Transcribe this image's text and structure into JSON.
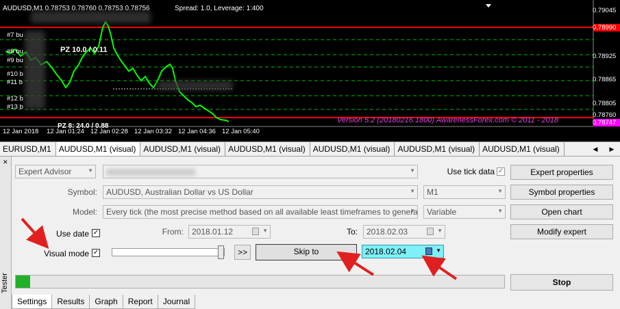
{
  "chart": {
    "title": "AUDUSD,M1  0.78753 0.78760 0.78753 0.78756",
    "spread_text": "Spread: 1.0, Leverage: 1:400",
    "price_labels": [
      "0.79045",
      "0.78990",
      "0.78925",
      "0.78865",
      "0.78805",
      "0.78760",
      "0.78747"
    ],
    "time_labels": [
      "12 Jan 2018",
      "12 Jan 01:24",
      "12 Jan 02:28",
      "12 Jan 03:32",
      "12 Jan 04:36",
      "12 Jan 05:40"
    ],
    "version_text": "Version 5.2 (20180216.1800) AwarenessForex.com © 2011 - 2018",
    "order_labels": [
      "#7 bu",
      "#8 bu",
      "#9 bu",
      "#10 b",
      "#11 b",
      "#12 b",
      "#13 b"
    ],
    "pz_top": "PZ 10.0 / 0.11",
    "pz_bottom": "PZ 8: 24.0 / 0.88",
    "line_color": "#00ff00",
    "level_color": "#ff0000"
  },
  "chart_tabs": [
    "EURUSD,M1",
    "AUDUSD,M1 (visual)",
    "AUDUSD,M1 (visual)",
    "AUDUSD,M1 (visual)",
    "AUDUSD,M1 (visual)",
    "AUDUSD,M1 (visual)",
    "AUDUSD,M1 (visual)"
  ],
  "tester": {
    "side_label": "Tester",
    "mode": "Expert Advisor",
    "use_tick_label": "Use tick data",
    "symbol_label": "Symbol:",
    "symbol_value": "AUDUSD, Australian Dollar vs US Dollar",
    "period_value": "M1",
    "model_label": "Model:",
    "model_value": "Every tick (the most precise method based on all available least timeframes to generate each t",
    "spread_value": "Variable",
    "use_date_label": "Use date",
    "from_label": "From:",
    "from_value": "2018.01.12",
    "to_label": "To:",
    "to_value": "2018.02.03",
    "visual_mode_label": "Visual mode",
    "fast_forward_label": ">>",
    "skip_to_label": "Skip to",
    "skip_to_value": "2018.02.04",
    "progress": 0.03,
    "buttons": {
      "expert_properties": "Expert properties",
      "symbol_properties": "Symbol properties",
      "open_chart": "Open chart",
      "modify_expert": "Modify expert",
      "stop": "Stop"
    },
    "tabs": [
      "Settings",
      "Results",
      "Graph",
      "Report",
      "Journal"
    ]
  }
}
